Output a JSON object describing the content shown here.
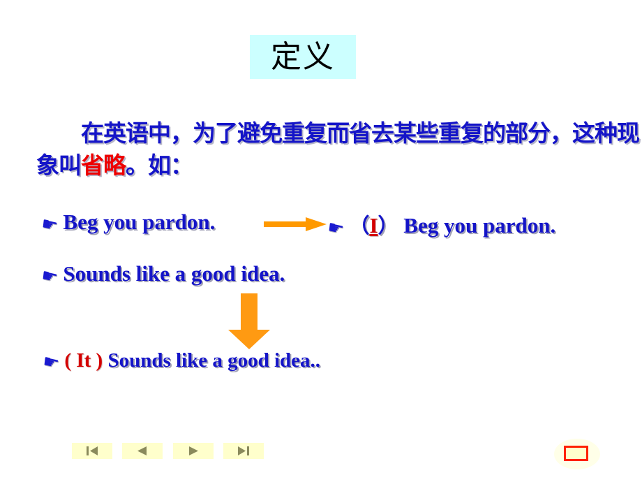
{
  "slide": {
    "title": "定义",
    "title_bg": "#ccffff",
    "body_color": "#1414c8",
    "accent_color": "#ee0000",
    "arrow_color": "#ff9900"
  },
  "paragraph": {
    "part_1": "在英语中，为了避免重复而省去某些重复的部分，这种现象叫",
    "highlight": "省略",
    "part_2": "。如："
  },
  "examples": [
    {
      "bullet": "pointing-hand-icon",
      "text": "Beg you pardon."
    },
    {
      "bullet": "pointing-hand-icon",
      "open_paren": "（",
      "inserted": "I",
      "close_paren": "）",
      "text": "Beg you pardon."
    },
    {
      "bullet": "pointing-hand-icon",
      "text": "Sounds like a good idea."
    },
    {
      "bullet": "pointing-hand-icon",
      "inserted": "( It )",
      "text": "Sounds like a good idea.."
    }
  ],
  "arrows": {
    "right_label": "right-arrow",
    "down_label": "down-arrow"
  },
  "nav": {
    "first": "|◀",
    "prev": "◀",
    "next": "▶",
    "last": "▶|",
    "button_bg": "#ffffcc",
    "glyph_color": "#8a8a5c"
  },
  "end_marker": {
    "border_color": "#ff2200",
    "fill_color": "#ffffcc"
  },
  "bullet_glyph": "☛"
}
